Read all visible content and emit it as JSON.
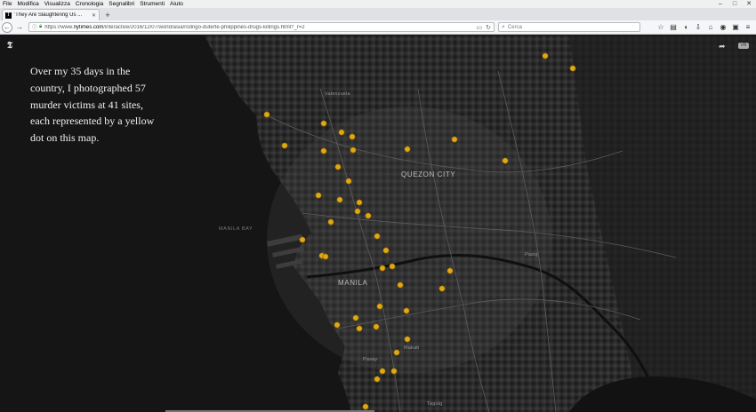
{
  "menu": {
    "items": [
      "File",
      "Modifica",
      "Visualizza",
      "Cronologia",
      "Segnalibri",
      "Strumenti",
      "Aiuto"
    ],
    "controls": [
      "–",
      "□",
      "✕"
    ]
  },
  "tab": {
    "favicon": "nyt-logo-icon",
    "title": "'They Are Slaughtering Us ...",
    "close": "✕",
    "new_tab": "+"
  },
  "nav": {
    "url_prefix": "https://www.",
    "url_domain": "nytimes.com",
    "url_path": "/interactive/2016/12/07/world/asia/rodrigo-duterte-philippines-drugs-killings.html?_r=2",
    "search_placeholder": "Cerca",
    "icons": [
      "back-icon",
      "forward-icon",
      "info-icon",
      "lock-icon",
      "reader-icon",
      "reload-icon",
      "bookmark-star-icon",
      "clipboard-icon",
      "download-icon",
      "home-icon",
      "pocket-icon",
      "sync-icon",
      "menu-icon"
    ]
  },
  "page": {
    "logo": "𝕿",
    "narrative": "Over my 35 days in the country, I photographed 57 murder victims at 41 sites, each represented by a yellow dot on this map.",
    "labels": {
      "quezon": "QUEZON CITY",
      "bay": "MANILA BAY",
      "manila": "MANILA",
      "valenzuela": "Valenzuela",
      "pasig": "Pasig",
      "makati": "Makati",
      "pasay": "Pasay",
      "taguig": "Taguig"
    },
    "dot_color": "#e0a815",
    "vr_label": "VR"
  }
}
